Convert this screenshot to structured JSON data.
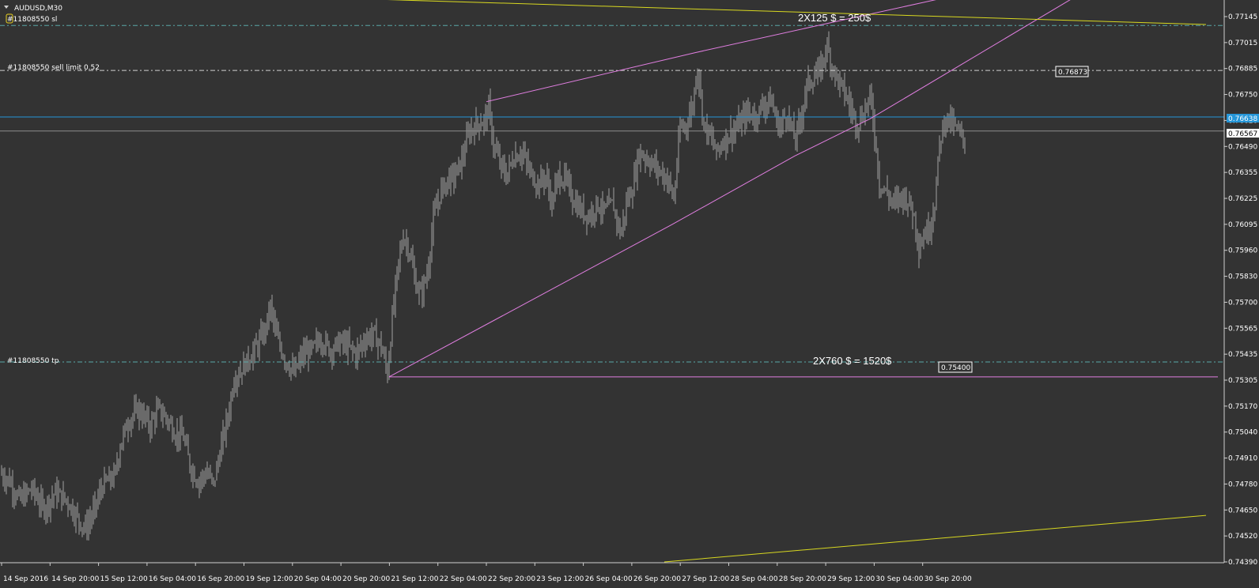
{
  "window": {
    "title": "AUDUSD,M30"
  },
  "colors": {
    "background": "#333333",
    "candle": "#a0a0a0",
    "channel": "#e07ee0",
    "trendline": "#d8d820",
    "order_line": "#5aa8a8",
    "bid_line": "#2596d8",
    "ask_line": "#8c8c8c",
    "sell_limit_line": "#d0d0d0",
    "text": "#ffffff"
  },
  "chart_data": {
    "type": "candlestick",
    "symbol": "AUDUSD",
    "timeframe": "M30",
    "ylim": [
      0.7432,
      0.7722
    ],
    "y_ticks": [
      "0.77145",
      "0.77015",
      "0.76885",
      "0.76750",
      "0.76620",
      "0.76490",
      "0.76355",
      "0.76225",
      "0.76095",
      "0.75960",
      "0.75830",
      "0.75700",
      "0.75565",
      "0.75435",
      "0.75305",
      "0.75170",
      "0.75040",
      "0.74910",
      "0.74780",
      "0.74650",
      "0.74520",
      "0.74390"
    ],
    "x_ticks": [
      "14 Sep 2016",
      "14 Sep 20:00",
      "15 Sep 12:00",
      "16 Sep 04:00",
      "16 Sep 20:00",
      "19 Sep 12:00",
      "20 Sep 04:00",
      "20 Sep 20:00",
      "21 Sep 12:00",
      "22 Sep 04:00",
      "22 Sep 20:00",
      "23 Sep 12:00",
      "26 Sep 04:00",
      "26 Sep 20:00",
      "27 Sep 12:00",
      "28 Sep 04:00",
      "28 Sep 20:00",
      "29 Sep 12:00",
      "30 Sep 04:00",
      "30 Sep 20:00"
    ],
    "grid": false,
    "price_path": [
      [
        0,
        0.7484
      ],
      [
        12,
        0.748
      ],
      [
        25,
        0.747
      ],
      [
        40,
        0.7476
      ],
      [
        55,
        0.7466
      ],
      [
        70,
        0.7474
      ],
      [
        85,
        0.747
      ],
      [
        100,
        0.746
      ],
      [
        108,
        0.7456
      ],
      [
        118,
        0.7464
      ],
      [
        130,
        0.7478
      ],
      [
        145,
        0.7482
      ],
      [
        152,
        0.7498
      ],
      [
        162,
        0.751
      ],
      [
        175,
        0.7516
      ],
      [
        190,
        0.7508
      ],
      [
        200,
        0.7516
      ],
      [
        210,
        0.7512
      ],
      [
        222,
        0.7504
      ],
      [
        232,
        0.7502
      ],
      [
        240,
        0.7488
      ],
      [
        250,
        0.748
      ],
      [
        262,
        0.7484
      ],
      [
        270,
        0.7478
      ],
      [
        280,
        0.7498
      ],
      [
        288,
        0.7512
      ],
      [
        296,
        0.7532
      ],
      [
        305,
        0.7536
      ],
      [
        315,
        0.7542
      ],
      [
        325,
        0.7548
      ],
      [
        335,
        0.7556
      ],
      [
        342,
        0.7568
      ],
      [
        350,
        0.7552
      ],
      [
        360,
        0.7542
      ],
      [
        372,
        0.7534
      ],
      [
        383,
        0.7544
      ],
      [
        395,
        0.7546
      ],
      [
        405,
        0.7552
      ],
      [
        418,
        0.7546
      ],
      [
        430,
        0.755
      ],
      [
        440,
        0.7548
      ],
      [
        450,
        0.7544
      ],
      [
        462,
        0.7552
      ],
      [
        472,
        0.7554
      ],
      [
        482,
        0.7548
      ],
      [
        490,
        0.7534
      ],
      [
        496,
        0.7562
      ],
      [
        503,
        0.7588
      ],
      [
        510,
        0.7604
      ],
      [
        518,
        0.7596
      ],
      [
        525,
        0.758
      ],
      [
        532,
        0.7574
      ],
      [
        540,
        0.7584
      ],
      [
        548,
        0.7612
      ],
      [
        557,
        0.7626
      ],
      [
        566,
        0.7632
      ],
      [
        575,
        0.7634
      ],
      [
        584,
        0.7642
      ],
      [
        593,
        0.7656
      ],
      [
        602,
        0.766
      ],
      [
        612,
        0.7662
      ],
      [
        618,
        0.7668
      ],
      [
        624,
        0.765
      ],
      [
        632,
        0.764
      ],
      [
        640,
        0.7634
      ],
      [
        650,
        0.7644
      ],
      [
        660,
        0.7646
      ],
      [
        670,
        0.7636
      ],
      [
        680,
        0.763
      ],
      [
        690,
        0.7634
      ],
      [
        698,
        0.762
      ],
      [
        706,
        0.7634
      ],
      [
        715,
        0.7632
      ],
      [
        725,
        0.7622
      ],
      [
        735,
        0.7616
      ],
      [
        745,
        0.7614
      ],
      [
        755,
        0.762
      ],
      [
        765,
        0.7616
      ],
      [
        775,
        0.762
      ],
      [
        785,
        0.7604
      ],
      [
        792,
        0.762
      ],
      [
        800,
        0.7628
      ],
      [
        808,
        0.7646
      ],
      [
        815,
        0.7644
      ],
      [
        825,
        0.764
      ],
      [
        835,
        0.7636
      ],
      [
        845,
        0.7632
      ],
      [
        852,
        0.7622
      ],
      [
        860,
        0.7658
      ],
      [
        868,
        0.766
      ],
      [
        876,
        0.767
      ],
      [
        882,
        0.769
      ],
      [
        890,
        0.766
      ],
      [
        898,
        0.7654
      ],
      [
        906,
        0.7646
      ],
      [
        915,
        0.7652
      ],
      [
        925,
        0.7656
      ],
      [
        935,
        0.766
      ],
      [
        945,
        0.7666
      ],
      [
        955,
        0.7664
      ],
      [
        965,
        0.767
      ],
      [
        975,
        0.7672
      ],
      [
        985,
        0.7658
      ],
      [
        995,
        0.7666
      ],
      [
        1005,
        0.7652
      ],
      [
        1012,
        0.7662
      ],
      [
        1020,
        0.768
      ],
      [
        1030,
        0.7684
      ],
      [
        1038,
        0.7688
      ],
      [
        1045,
        0.77
      ],
      [
        1052,
        0.769
      ],
      [
        1060,
        0.7682
      ],
      [
        1068,
        0.7676
      ],
      [
        1076,
        0.7668
      ],
      [
        1084,
        0.766
      ],
      [
        1092,
        0.7666
      ],
      [
        1100,
        0.7674
      ],
      [
        1105,
        0.766
      ],
      [
        1112,
        0.763
      ],
      [
        1120,
        0.7626
      ],
      [
        1130,
        0.762
      ],
      [
        1140,
        0.7624
      ],
      [
        1148,
        0.7622
      ],
      [
        1156,
        0.7614
      ],
      [
        1162,
        0.7598
      ],
      [
        1168,
        0.7604
      ],
      [
        1175,
        0.7608
      ],
      [
        1182,
        0.762
      ],
      [
        1188,
        0.765
      ],
      [
        1195,
        0.7664
      ],
      [
        1205,
        0.766
      ],
      [
        1212,
        0.7656
      ],
      [
        1220,
        0.7652
      ]
    ],
    "lines": {
      "sl_price": 0.771,
      "sell_limit_price": 0.76873,
      "tp_price": 0.754,
      "bid": 0.76638,
      "ask": 0.76567,
      "channel_upper": [
        [
          615,
          0.76715
        ],
        [
          878,
          0.76962
        ],
        [
          1040,
          0.77105
        ],
        [
          1240,
          0.7728
        ]
      ],
      "channel_lower": [
        [
          492,
          0.75325
        ],
        [
          850,
          0.76095
        ],
        [
          1005,
          0.76441
        ],
        [
          1100,
          0.76628
        ],
        [
          1370,
          0.7727
        ]
      ],
      "channel_base": [
        [
          492,
          0.75325
        ],
        [
          1540,
          0.75325
        ]
      ],
      "trend_top": [
        [
          480,
          0.77232
        ],
        [
          1525,
          0.77105
        ]
      ],
      "trend_bottom": [
        [
          840,
          0.7439
        ],
        [
          1525,
          0.74625
        ]
      ]
    },
    "annotations": {
      "top_text": "2X125 $ = 250$",
      "bottom_text": "2X760 $ = 1520$",
      "sell_limit_box": "0.76873",
      "tp_box": "0.75400",
      "bid_label": "0.76638",
      "ask_label": "0.76567"
    },
    "order_labels": {
      "sl": "#11808550 sl",
      "sell_limit": "#11808550 sell limit 0.52",
      "tp": "#11808550 tp"
    }
  }
}
